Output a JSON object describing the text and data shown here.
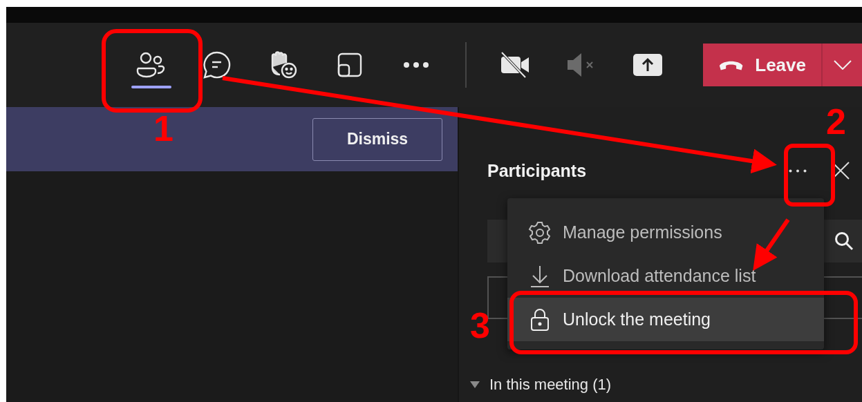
{
  "toolbar": {
    "buttons": [
      {
        "kind": "people",
        "selected": true,
        "disabled": false
      },
      {
        "kind": "chat",
        "selected": false,
        "disabled": false
      },
      {
        "kind": "reactions",
        "selected": false,
        "disabled": false
      },
      {
        "kind": "view",
        "selected": false,
        "disabled": false
      },
      {
        "kind": "more",
        "selected": false,
        "disabled": false
      },
      {
        "kind": "camera",
        "selected": false,
        "disabled": false
      },
      {
        "kind": "speaker",
        "selected": false,
        "disabled": true
      },
      {
        "kind": "share",
        "selected": false,
        "disabled": false
      }
    ],
    "leave": {
      "label": "Leave"
    }
  },
  "banner": {
    "button": "Dismiss"
  },
  "panel": {
    "title": "Participants",
    "section": {
      "label": "In this meeting (1)",
      "expanded": true
    }
  },
  "menu": {
    "items": [
      {
        "kind": "gear",
        "label": "Manage permissions",
        "selected": false
      },
      {
        "kind": "download",
        "label": "Download attendance list",
        "selected": false
      },
      {
        "kind": "lock",
        "label": "Unlock the meeting",
        "selected": true
      }
    ]
  },
  "annotations": [
    "1",
    "2",
    "3"
  ]
}
